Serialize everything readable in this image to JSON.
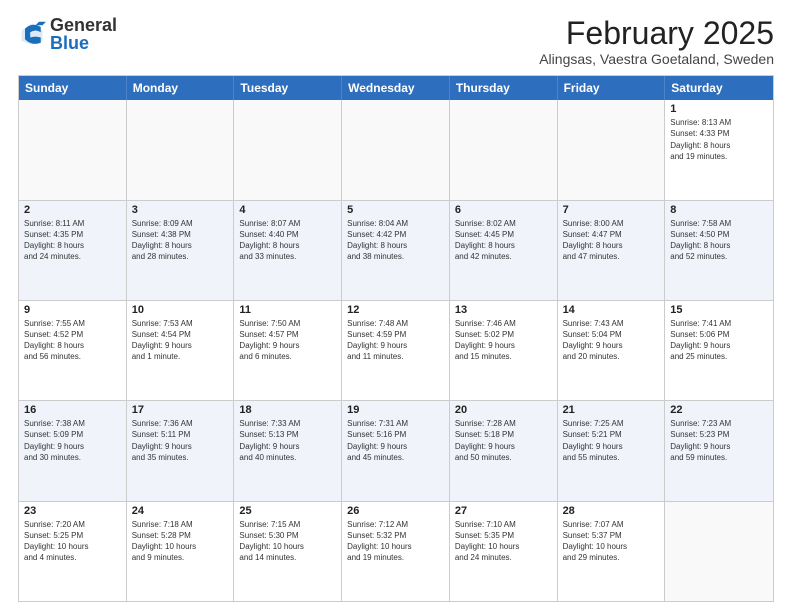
{
  "header": {
    "logo_general": "General",
    "logo_blue": "Blue",
    "month_title": "February 2025",
    "location": "Alingsas, Vaestra Goetaland, Sweden"
  },
  "days_of_week": [
    "Sunday",
    "Monday",
    "Tuesday",
    "Wednesday",
    "Thursday",
    "Friday",
    "Saturday"
  ],
  "weeks": [
    {
      "alt": false,
      "cells": [
        {
          "empty": true,
          "day": "",
          "info": ""
        },
        {
          "empty": true,
          "day": "",
          "info": ""
        },
        {
          "empty": true,
          "day": "",
          "info": ""
        },
        {
          "empty": true,
          "day": "",
          "info": ""
        },
        {
          "empty": true,
          "day": "",
          "info": ""
        },
        {
          "empty": true,
          "day": "",
          "info": ""
        },
        {
          "empty": false,
          "day": "1",
          "info": "Sunrise: 8:13 AM\nSunset: 4:33 PM\nDaylight: 8 hours\nand 19 minutes."
        }
      ]
    },
    {
      "alt": true,
      "cells": [
        {
          "empty": false,
          "day": "2",
          "info": "Sunrise: 8:11 AM\nSunset: 4:35 PM\nDaylight: 8 hours\nand 24 minutes."
        },
        {
          "empty": false,
          "day": "3",
          "info": "Sunrise: 8:09 AM\nSunset: 4:38 PM\nDaylight: 8 hours\nand 28 minutes."
        },
        {
          "empty": false,
          "day": "4",
          "info": "Sunrise: 8:07 AM\nSunset: 4:40 PM\nDaylight: 8 hours\nand 33 minutes."
        },
        {
          "empty": false,
          "day": "5",
          "info": "Sunrise: 8:04 AM\nSunset: 4:42 PM\nDaylight: 8 hours\nand 38 minutes."
        },
        {
          "empty": false,
          "day": "6",
          "info": "Sunrise: 8:02 AM\nSunset: 4:45 PM\nDaylight: 8 hours\nand 42 minutes."
        },
        {
          "empty": false,
          "day": "7",
          "info": "Sunrise: 8:00 AM\nSunset: 4:47 PM\nDaylight: 8 hours\nand 47 minutes."
        },
        {
          "empty": false,
          "day": "8",
          "info": "Sunrise: 7:58 AM\nSunset: 4:50 PM\nDaylight: 8 hours\nand 52 minutes."
        }
      ]
    },
    {
      "alt": false,
      "cells": [
        {
          "empty": false,
          "day": "9",
          "info": "Sunrise: 7:55 AM\nSunset: 4:52 PM\nDaylight: 8 hours\nand 56 minutes."
        },
        {
          "empty": false,
          "day": "10",
          "info": "Sunrise: 7:53 AM\nSunset: 4:54 PM\nDaylight: 9 hours\nand 1 minute."
        },
        {
          "empty": false,
          "day": "11",
          "info": "Sunrise: 7:50 AM\nSunset: 4:57 PM\nDaylight: 9 hours\nand 6 minutes."
        },
        {
          "empty": false,
          "day": "12",
          "info": "Sunrise: 7:48 AM\nSunset: 4:59 PM\nDaylight: 9 hours\nand 11 minutes."
        },
        {
          "empty": false,
          "day": "13",
          "info": "Sunrise: 7:46 AM\nSunset: 5:02 PM\nDaylight: 9 hours\nand 15 minutes."
        },
        {
          "empty": false,
          "day": "14",
          "info": "Sunrise: 7:43 AM\nSunset: 5:04 PM\nDaylight: 9 hours\nand 20 minutes."
        },
        {
          "empty": false,
          "day": "15",
          "info": "Sunrise: 7:41 AM\nSunset: 5:06 PM\nDaylight: 9 hours\nand 25 minutes."
        }
      ]
    },
    {
      "alt": true,
      "cells": [
        {
          "empty": false,
          "day": "16",
          "info": "Sunrise: 7:38 AM\nSunset: 5:09 PM\nDaylight: 9 hours\nand 30 minutes."
        },
        {
          "empty": false,
          "day": "17",
          "info": "Sunrise: 7:36 AM\nSunset: 5:11 PM\nDaylight: 9 hours\nand 35 minutes."
        },
        {
          "empty": false,
          "day": "18",
          "info": "Sunrise: 7:33 AM\nSunset: 5:13 PM\nDaylight: 9 hours\nand 40 minutes."
        },
        {
          "empty": false,
          "day": "19",
          "info": "Sunrise: 7:31 AM\nSunset: 5:16 PM\nDaylight: 9 hours\nand 45 minutes."
        },
        {
          "empty": false,
          "day": "20",
          "info": "Sunrise: 7:28 AM\nSunset: 5:18 PM\nDaylight: 9 hours\nand 50 minutes."
        },
        {
          "empty": false,
          "day": "21",
          "info": "Sunrise: 7:25 AM\nSunset: 5:21 PM\nDaylight: 9 hours\nand 55 minutes."
        },
        {
          "empty": false,
          "day": "22",
          "info": "Sunrise: 7:23 AM\nSunset: 5:23 PM\nDaylight: 9 hours\nand 59 minutes."
        }
      ]
    },
    {
      "alt": false,
      "cells": [
        {
          "empty": false,
          "day": "23",
          "info": "Sunrise: 7:20 AM\nSunset: 5:25 PM\nDaylight: 10 hours\nand 4 minutes."
        },
        {
          "empty": false,
          "day": "24",
          "info": "Sunrise: 7:18 AM\nSunset: 5:28 PM\nDaylight: 10 hours\nand 9 minutes."
        },
        {
          "empty": false,
          "day": "25",
          "info": "Sunrise: 7:15 AM\nSunset: 5:30 PM\nDaylight: 10 hours\nand 14 minutes."
        },
        {
          "empty": false,
          "day": "26",
          "info": "Sunrise: 7:12 AM\nSunset: 5:32 PM\nDaylight: 10 hours\nand 19 minutes."
        },
        {
          "empty": false,
          "day": "27",
          "info": "Sunrise: 7:10 AM\nSunset: 5:35 PM\nDaylight: 10 hours\nand 24 minutes."
        },
        {
          "empty": false,
          "day": "28",
          "info": "Sunrise: 7:07 AM\nSunset: 5:37 PM\nDaylight: 10 hours\nand 29 minutes."
        },
        {
          "empty": true,
          "day": "",
          "info": ""
        }
      ]
    }
  ]
}
